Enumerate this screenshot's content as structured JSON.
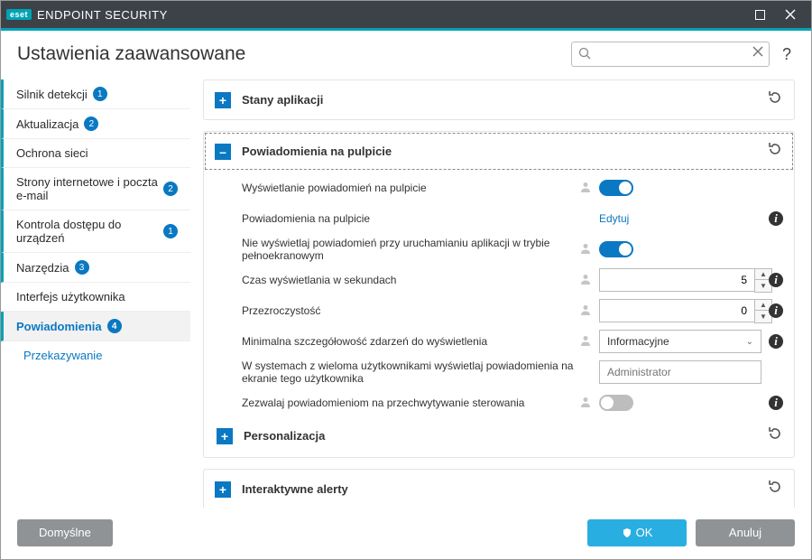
{
  "titlebar": {
    "brand_logo": "eset",
    "brand_text": "ENDPOINT SECURITY"
  },
  "header": {
    "title": "Ustawienia zaawansowane",
    "search_placeholder": ""
  },
  "sidebar": {
    "items": [
      {
        "label": "Silnik detekcji",
        "badge": "1"
      },
      {
        "label": "Aktualizacja",
        "badge": "2"
      },
      {
        "label": "Ochrona sieci",
        "badge": ""
      },
      {
        "label": "Strony internetowe i poczta e-mail",
        "badge": "2"
      },
      {
        "label": "Kontrola dostępu do urządzeń",
        "badge": "1"
      },
      {
        "label": "Narzędzia",
        "badge": "3"
      },
      {
        "label": "Interfejs użytkownika",
        "badge": ""
      },
      {
        "label": "Powiadomienia",
        "badge": "4"
      },
      {
        "label": "Przekazywanie",
        "badge": ""
      }
    ]
  },
  "panels": {
    "app_states": {
      "title": "Stany aplikacji"
    },
    "desktop_notifications": {
      "title": "Powiadomienia na pulpicie",
      "rows": {
        "show": {
          "label": "Wyświetlanie powiadomień na pulpicie"
        },
        "edit": {
          "label": "Powiadomienia na pulpicie",
          "link": "Edytuj"
        },
        "fullscreen": {
          "label": "Nie wyświetlaj powiadomień przy uruchamianiu aplikacji w trybie pełnoekranowym"
        },
        "duration": {
          "label": "Czas wyświetlania w sekundach",
          "value": "5"
        },
        "transparency": {
          "label": "Przezroczystość",
          "value": "0"
        },
        "verbosity": {
          "label": "Minimalna szczegółowość zdarzeń do wyświetlenia",
          "value": "Informacyjne"
        },
        "multiuser": {
          "label": "W systemach z wieloma użytkownikami wyświetlaj powiadomienia na ekranie tego użytkownika",
          "value": "Administrator"
        },
        "steal_focus": {
          "label": "Zezwalaj powiadomieniom na przechwytywanie sterowania"
        }
      },
      "personalization": "Personalizacja"
    },
    "interactive_alerts": {
      "title": "Interaktywne alerty"
    }
  },
  "footer": {
    "defaults": "Domyślne",
    "ok": "OK",
    "cancel": "Anuluj"
  }
}
